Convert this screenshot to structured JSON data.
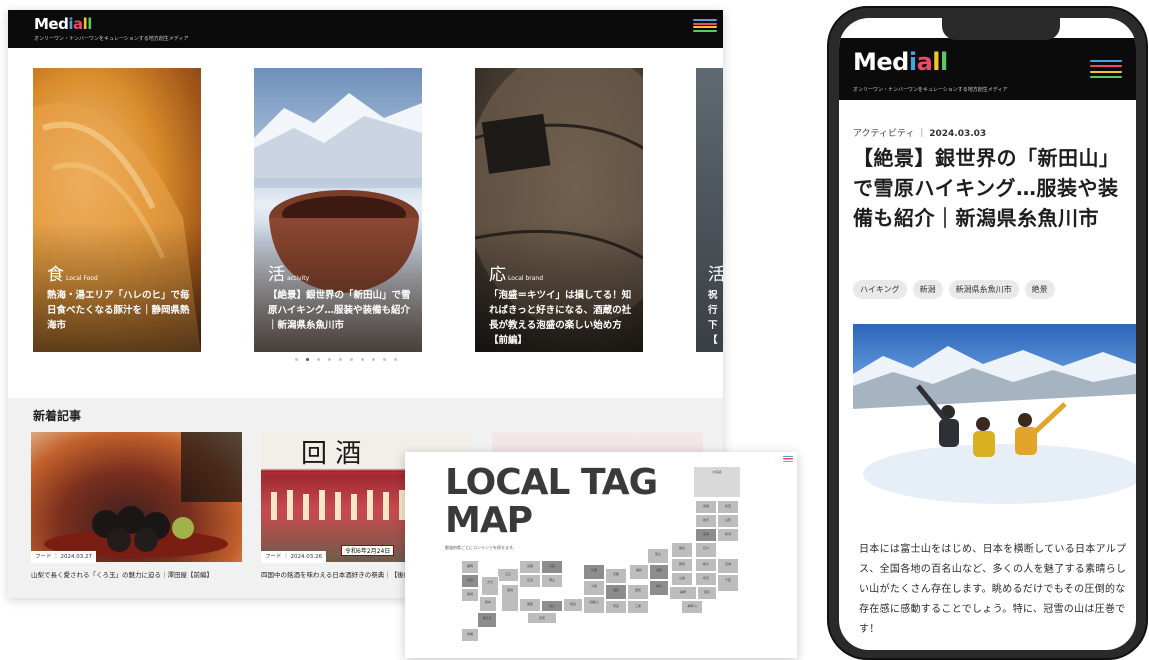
{
  "colors": {
    "header_bg": "#0b0b0b",
    "logo_blue": "#4aa3df",
    "logo_red": "#e94b6b",
    "logo_yellow": "#f2c230",
    "logo_green": "#5cc46a"
  },
  "brand": {
    "logo_prefix": "Med",
    "logo_i": "i",
    "logo_a": "a",
    "logo_l1": "l",
    "logo_l2": "l",
    "tagline": "オンリーワン・ナンバーワンをキュレーションする地方創生メディア"
  },
  "desktop": {
    "slides": [
      {
        "category": "食",
        "category_en": "Local Food",
        "title": "熱海・湯エリア「ハレのヒ」で毎日食べたくなる豚汁を｜静岡県熱海市"
      },
      {
        "category": "活",
        "category_en": "activity",
        "title": "【絶景】銀世界の「新田山」で雪原ハイキング…服装や装備も紹介｜新潟県糸魚川市"
      },
      {
        "category": "応",
        "category_en": "Local brand",
        "title": "「泡盛＝キツイ」は損してる！知ればきっと好きになる、酒蔵の社長が教える泡盛の楽しい始め方【前編】"
      },
      {
        "category": "活",
        "category_en": "",
        "title": "祝行下【"
      }
    ],
    "pagination_count": 10,
    "news_heading": "新着記事",
    "news": [
      {
        "meta": "フード ｜ 2024.03.27",
        "title": "山梨で長く愛される「くろ玉」の魅力に迫る｜澤田屋【前編】"
      },
      {
        "meta": "フード ｜ 2024.03.26",
        "title": "四国中の銘酒を味わえる日本酒好きの祭典｜【後編】"
      },
      {
        "meta": "",
        "title": ""
      }
    ],
    "news_badge": "令和6年2月24日"
  },
  "map": {
    "title_line1": "LOCAL TAG",
    "title_line2": "MAP",
    "subtitle": "都道府県ごとにコンテンツを探せます。",
    "prefectures": [
      "北海道",
      "青森",
      "秋田",
      "岩手",
      "山形",
      "宮城",
      "新潟",
      "福島",
      "石川",
      "富山",
      "長野",
      "群馬",
      "栃木",
      "茨城",
      "福井",
      "岐阜",
      "山梨",
      "埼玉",
      "千葉",
      "京都",
      "滋賀",
      "愛知",
      "静岡",
      "東京",
      "神奈川",
      "兵庫",
      "大阪",
      "奈良",
      "三重",
      "和歌山",
      "鳥取",
      "島根",
      "岡山",
      "広島",
      "山口",
      "香川",
      "徳島",
      "愛媛",
      "高知",
      "福岡",
      "佐賀",
      "長崎",
      "大分",
      "熊本",
      "宮崎",
      "鹿児島",
      "沖縄"
    ]
  },
  "phone": {
    "category": "アクティビティ",
    "separator": "｜",
    "date": "2024.03.03",
    "title": "【絶景】銀世界の「新田山」で雪原ハイキング…服装や装備も紹介｜新潟県糸魚川市",
    "tags": [
      "ハイキング",
      "新潟",
      "新潟県糸魚川市",
      "絶景"
    ],
    "body": "日本には富士山をはじめ、日本を横断している日本アルプス、全国各地の百名山など、多くの人を魅了する素晴らしい山がたくさん存在します。眺めるだけでもその圧倒的な存在感に感動することでしょう。特に、冠雪の山は圧巻です！"
  }
}
